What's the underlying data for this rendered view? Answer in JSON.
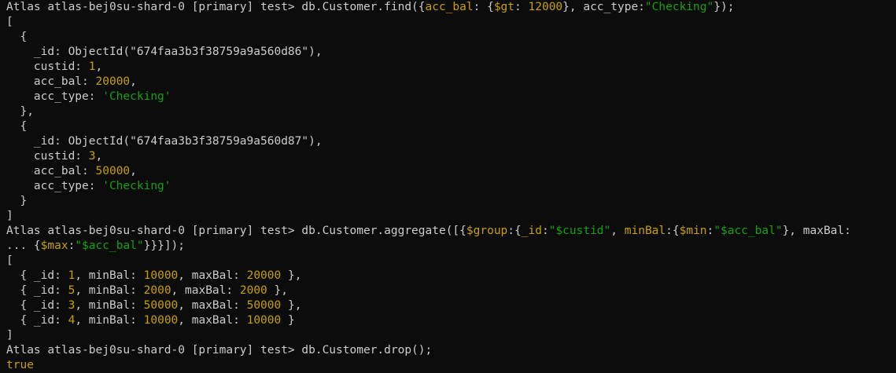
{
  "terminal": {
    "colors": {
      "background": "#0c0c0c",
      "default": "#cccccc",
      "number": "#c7a000",
      "string": "#13a10e",
      "operator": "#c7a000",
      "boolean": "#c7a000"
    },
    "lines": [
      {
        "segments": [
          {
            "t": "Atlas atlas-bej0su-shard-0 [primary] test> db.Customer.find({",
            "c": "def"
          },
          {
            "t": "acc_bal",
            "c": "yellow"
          },
          {
            "t": ": {",
            "c": "def"
          },
          {
            "t": "$gt",
            "c": "yellow"
          },
          {
            "t": ": ",
            "c": "def"
          },
          {
            "t": "12000",
            "c": "num"
          },
          {
            "t": "}, acc_type:",
            "c": "def"
          },
          {
            "t": "\"Checking\"",
            "c": "str"
          },
          {
            "t": "});",
            "c": "def"
          }
        ]
      },
      {
        "segments": [
          {
            "t": "[",
            "c": "def"
          }
        ]
      },
      {
        "segments": [
          {
            "t": "  {",
            "c": "def"
          }
        ]
      },
      {
        "segments": [
          {
            "t": "    _id: ObjectId(\"674faa3b3f38759a9a560d86\"),",
            "c": "def"
          }
        ]
      },
      {
        "segments": [
          {
            "t": "    custid: ",
            "c": "def"
          },
          {
            "t": "1",
            "c": "num"
          },
          {
            "t": ",",
            "c": "def"
          }
        ]
      },
      {
        "segments": [
          {
            "t": "    acc_bal: ",
            "c": "def"
          },
          {
            "t": "20000",
            "c": "num"
          },
          {
            "t": ",",
            "c": "def"
          }
        ]
      },
      {
        "segments": [
          {
            "t": "    acc_type: ",
            "c": "def"
          },
          {
            "t": "'Checking'",
            "c": "str"
          }
        ]
      },
      {
        "segments": [
          {
            "t": "  },",
            "c": "def"
          }
        ]
      },
      {
        "segments": [
          {
            "t": "  {",
            "c": "def"
          }
        ]
      },
      {
        "segments": [
          {
            "t": "    _id: ObjectId(\"674faa3b3f38759a9a560d87\"),",
            "c": "def"
          }
        ]
      },
      {
        "segments": [
          {
            "t": "    custid: ",
            "c": "def"
          },
          {
            "t": "3",
            "c": "num"
          },
          {
            "t": ",",
            "c": "def"
          }
        ]
      },
      {
        "segments": [
          {
            "t": "    acc_bal: ",
            "c": "def"
          },
          {
            "t": "50000",
            "c": "num"
          },
          {
            "t": ",",
            "c": "def"
          }
        ]
      },
      {
        "segments": [
          {
            "t": "    acc_type: ",
            "c": "def"
          },
          {
            "t": "'Checking'",
            "c": "str"
          }
        ]
      },
      {
        "segments": [
          {
            "t": "  }",
            "c": "def"
          }
        ]
      },
      {
        "segments": [
          {
            "t": "]",
            "c": "def"
          }
        ]
      },
      {
        "segments": [
          {
            "t": "Atlas atlas-bej0su-shard-0 [primary] test> db.Customer.aggregate([{",
            "c": "def"
          },
          {
            "t": "$group",
            "c": "yellow"
          },
          {
            "t": ":{",
            "c": "def"
          },
          {
            "t": "_id",
            "c": "yellow"
          },
          {
            "t": ":",
            "c": "def"
          },
          {
            "t": "\"$custid\"",
            "c": "str"
          },
          {
            "t": ", ",
            "c": "def"
          },
          {
            "t": "minBal",
            "c": "yellow"
          },
          {
            "t": ":{",
            "c": "def"
          },
          {
            "t": "$min",
            "c": "yellow"
          },
          {
            "t": ":",
            "c": "def"
          },
          {
            "t": "\"$acc_bal\"",
            "c": "str"
          },
          {
            "t": "}, maxBal:",
            "c": "def"
          }
        ]
      },
      {
        "segments": [
          {
            "t": "... {",
            "c": "def"
          },
          {
            "t": "$max",
            "c": "yellow"
          },
          {
            "t": ":",
            "c": "def"
          },
          {
            "t": "\"$acc_bal\"",
            "c": "str"
          },
          {
            "t": "}}}]);",
            "c": "def"
          }
        ]
      },
      {
        "segments": [
          {
            "t": "[",
            "c": "def"
          }
        ]
      },
      {
        "segments": [
          {
            "t": "  { _id: ",
            "c": "def"
          },
          {
            "t": "1",
            "c": "num"
          },
          {
            "t": ", minBal: ",
            "c": "def"
          },
          {
            "t": "10000",
            "c": "num"
          },
          {
            "t": ", maxBal: ",
            "c": "def"
          },
          {
            "t": "20000",
            "c": "num"
          },
          {
            "t": " },",
            "c": "def"
          }
        ]
      },
      {
        "segments": [
          {
            "t": "  { _id: ",
            "c": "def"
          },
          {
            "t": "5",
            "c": "num"
          },
          {
            "t": ", minBal: ",
            "c": "def"
          },
          {
            "t": "2000",
            "c": "num"
          },
          {
            "t": ", maxBal: ",
            "c": "def"
          },
          {
            "t": "2000",
            "c": "num"
          },
          {
            "t": " },",
            "c": "def"
          }
        ]
      },
      {
        "segments": [
          {
            "t": "  { _id: ",
            "c": "def"
          },
          {
            "t": "3",
            "c": "num"
          },
          {
            "t": ", minBal: ",
            "c": "def"
          },
          {
            "t": "50000",
            "c": "num"
          },
          {
            "t": ", maxBal: ",
            "c": "def"
          },
          {
            "t": "50000",
            "c": "num"
          },
          {
            "t": " },",
            "c": "def"
          }
        ]
      },
      {
        "segments": [
          {
            "t": "  { _id: ",
            "c": "def"
          },
          {
            "t": "4",
            "c": "num"
          },
          {
            "t": ", minBal: ",
            "c": "def"
          },
          {
            "t": "10000",
            "c": "num"
          },
          {
            "t": ", maxBal: ",
            "c": "def"
          },
          {
            "t": "10000",
            "c": "num"
          },
          {
            "t": " }",
            "c": "def"
          }
        ]
      },
      {
        "segments": [
          {
            "t": "]",
            "c": "def"
          }
        ]
      },
      {
        "segments": [
          {
            "t": "Atlas atlas-bej0su-shard-0 [primary] test> db.Customer.drop();",
            "c": "def"
          }
        ]
      },
      {
        "segments": [
          {
            "t": "true",
            "c": "yellow"
          }
        ]
      }
    ]
  }
}
